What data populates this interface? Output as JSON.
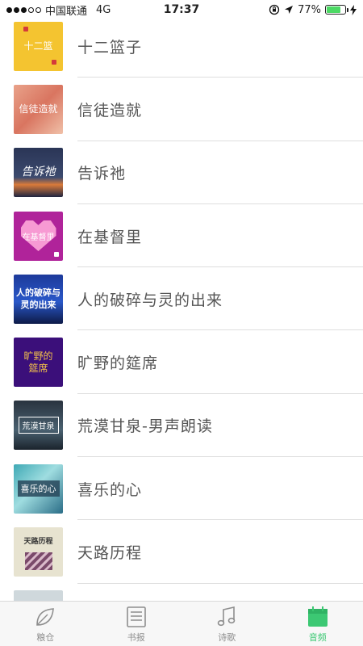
{
  "status_bar": {
    "carrier": "中国联通",
    "network": "4G",
    "time": "17:37",
    "battery_percent": "77%",
    "battery_level": 0.77,
    "signal_bars": 3
  },
  "list": {
    "items": [
      {
        "title": "十二篮子",
        "cover_text": "十二篮"
      },
      {
        "title": "信徒造就",
        "cover_text": "信徒造就"
      },
      {
        "title": "告诉祂",
        "cover_text": "告诉祂"
      },
      {
        "title": "在基督里",
        "cover_text": "在基督里"
      },
      {
        "title": "人的破碎与灵的出来",
        "cover_text": "人的破碎与灵的出来"
      },
      {
        "title": "旷野的筵席",
        "cover_text": "旷野的筵席"
      },
      {
        "title": "荒漠甘泉-男声朗读",
        "cover_text": "荒漠甘泉"
      },
      {
        "title": "喜乐的心",
        "cover_text": "喜乐的心"
      },
      {
        "title": "天路历程",
        "cover_text": "天路历程"
      },
      {
        "title": "",
        "cover_text": ""
      }
    ]
  },
  "tab_bar": {
    "tabs": [
      {
        "label": "粮仓",
        "icon": "leaf-icon"
      },
      {
        "label": "书报",
        "icon": "newspaper-icon"
      },
      {
        "label": "诗歌",
        "icon": "music-note-icon"
      },
      {
        "label": "音频",
        "icon": "calendar-icon"
      }
    ],
    "active_index": 3
  },
  "colors": {
    "accent": "#3cc873",
    "inactive": "#8e8e8e",
    "divider": "#dedede",
    "battery": "#4cd964"
  }
}
